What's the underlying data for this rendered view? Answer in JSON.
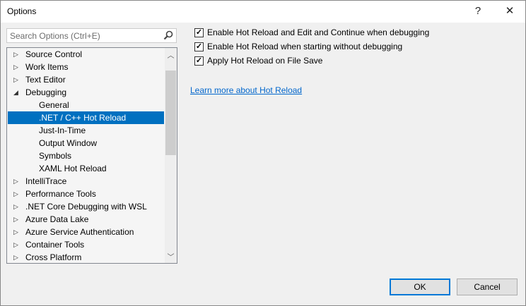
{
  "window": {
    "title": "Options",
    "help": "?",
    "close": "✕"
  },
  "search": {
    "placeholder": "Search Options (Ctrl+E)",
    "value": ""
  },
  "tree": [
    {
      "label": "Source Control",
      "level": 0,
      "expander": "collapsed"
    },
    {
      "label": "Work Items",
      "level": 0,
      "expander": "collapsed"
    },
    {
      "label": "Text Editor",
      "level": 0,
      "expander": "collapsed"
    },
    {
      "label": "Debugging",
      "level": 0,
      "expander": "expanded"
    },
    {
      "label": "General",
      "level": 1
    },
    {
      "label": ".NET / C++ Hot Reload",
      "level": 1,
      "selected": true
    },
    {
      "label": "Just-In-Time",
      "level": 1
    },
    {
      "label": "Output Window",
      "level": 1
    },
    {
      "label": "Symbols",
      "level": 1
    },
    {
      "label": "XAML Hot Reload",
      "level": 1
    },
    {
      "label": "IntelliTrace",
      "level": 0,
      "expander": "collapsed"
    },
    {
      "label": "Performance Tools",
      "level": 0,
      "expander": "collapsed"
    },
    {
      "label": ".NET Core Debugging with WSL",
      "level": 0,
      "expander": "collapsed"
    },
    {
      "label": "Azure Data Lake",
      "level": 0,
      "expander": "collapsed"
    },
    {
      "label": "Azure Service Authentication",
      "level": 0,
      "expander": "collapsed"
    },
    {
      "label": "Container Tools",
      "level": 0,
      "expander": "collapsed"
    },
    {
      "label": "Cross Platform",
      "level": 0,
      "expander": "collapsed"
    }
  ],
  "options": [
    {
      "label": "Enable Hot Reload and Edit and Continue when debugging",
      "checked": true
    },
    {
      "label": "Enable Hot Reload when starting without debugging",
      "checked": true
    },
    {
      "label": "Apply Hot Reload on File Save",
      "checked": true
    }
  ],
  "link": "Learn more about Hot Reload",
  "buttons": {
    "ok": "OK",
    "cancel": "Cancel"
  },
  "colors": {
    "selection": "#0070c0",
    "link": "#0066cc",
    "default_border": "#0078d7"
  }
}
